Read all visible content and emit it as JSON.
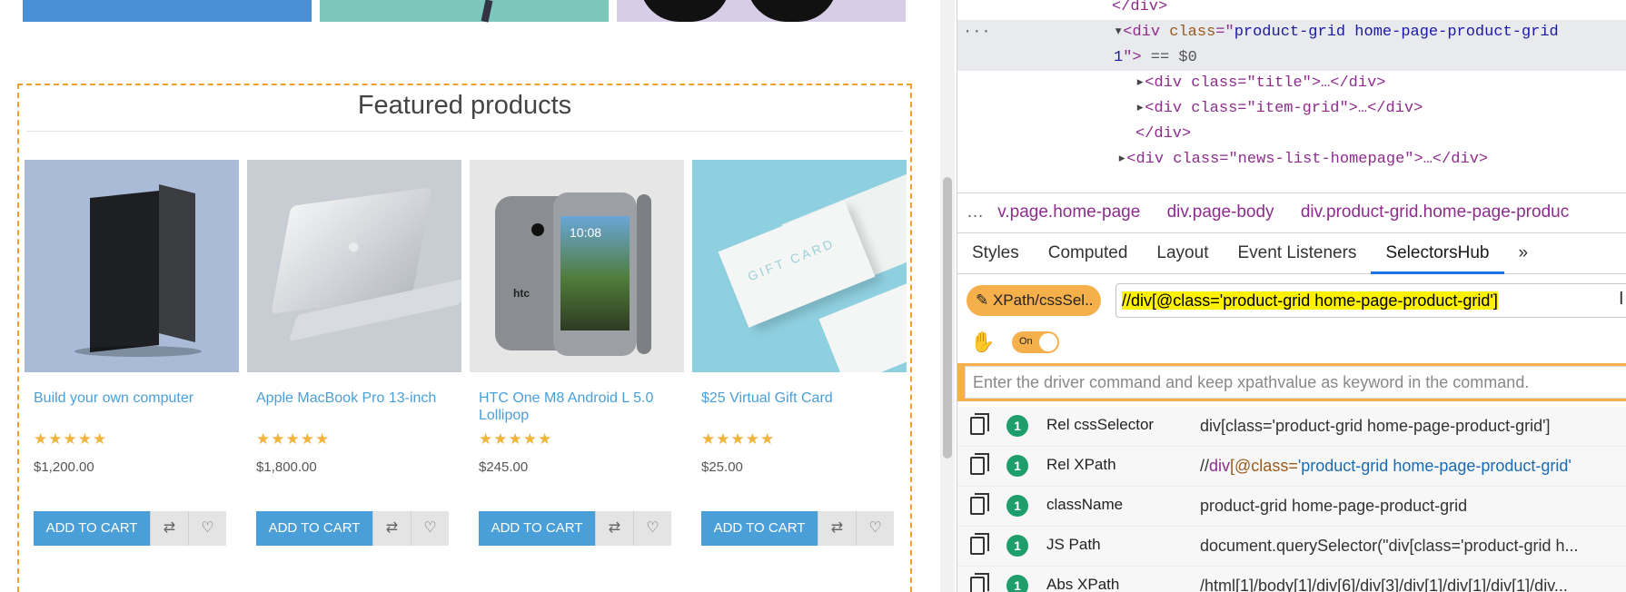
{
  "page": {
    "featured_title": "Featured products",
    "products": [
      {
        "name": "Build your own computer",
        "price": "$1,200.00",
        "stars": "★★★★★",
        "add_label": "ADD TO CART",
        "compare_icon": "⇄",
        "wishlist_icon": "♡"
      },
      {
        "name": "Apple MacBook Pro 13-inch",
        "price": "$1,800.00",
        "stars": "★★★★★",
        "add_label": "ADD TO CART",
        "compare_icon": "⇄",
        "wishlist_icon": "♡"
      },
      {
        "name": "HTC One M8 Android L 5.0 Lollipop",
        "price": "$245.00",
        "stars": "★★★★★",
        "add_label": "ADD TO CART",
        "compare_icon": "⇄",
        "wishlist_icon": "♡"
      },
      {
        "name": "$25 Virtual Gift Card",
        "price": "$25.00",
        "stars": "★★★★★",
        "add_label": "ADD TO CART",
        "compare_icon": "⇄",
        "wishlist_icon": "♡"
      }
    ],
    "image_text": {
      "htc": "htc",
      "time": "10:08",
      "gift": "GIFT CARD"
    }
  },
  "devtools": {
    "elements": {
      "l0": "</div>",
      "l1a": "<div ",
      "l1b": "class",
      "l1c": "=\"",
      "l1d": "product-grid home-page-product-grid",
      "l2a": "1",
      "l2b": "\">",
      "l2c": " == $0",
      "l3": "<div class=\"title\">…</div>",
      "l4": "<div class=\"item-grid\">…</div>",
      "l5": "</div>",
      "l6": "<div class=\"news-list-homepage\">…</div>",
      "dots": "···"
    },
    "breadcrumbs": [
      "v.page.home-page",
      "div.page-body",
      "div.product-grid.home-page-produc"
    ],
    "tabs": [
      "Styles",
      "Computed",
      "Layout",
      "Event Listeners",
      "SelectorsHub",
      "»"
    ],
    "selectorshub": {
      "mode_label": "XPath/cssSel..",
      "query": "//div[@class='product-grid home-page-product-grid']",
      "toggle_label": "On",
      "driver_placeholder": "Enter the driver command and keep xpathvalue as keyword in the command."
    },
    "results": [
      {
        "label": "Rel cssSelector",
        "count": "1",
        "value": "div[class='product-grid home-page-product-grid']"
      },
      {
        "label": "Rel XPath",
        "count": "1",
        "value": "//div[@class='product-grid home-page-product-grid']"
      },
      {
        "label": "className",
        "count": "1",
        "value": "product-grid home-page-product-grid"
      },
      {
        "label": "JS Path",
        "count": "1",
        "value": "document.querySelector(\"div[class='product-grid h..."
      },
      {
        "label": "Abs XPath",
        "count": "1",
        "value": "/html[1]/body[1]/div[6]/div[3]/div[1]/div[1]/div[1]/div..."
      }
    ],
    "rel_xpath_parts": [
      "//",
      "div",
      "[@class=",
      "'product-grid home-page-product-grid'"
    ]
  },
  "colors": {
    "accent": "#4a9fd8",
    "selector_mode": "#f5b04c",
    "highlight": "#fff200",
    "badge": "#1d9e6b"
  }
}
